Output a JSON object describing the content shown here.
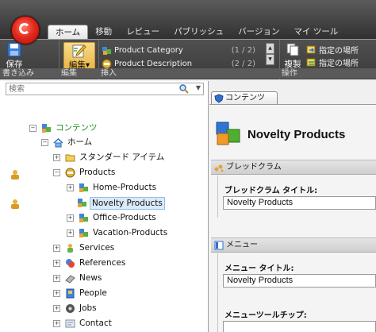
{
  "ribbon": {
    "tabs": [
      "ホーム",
      "移動",
      "レビュー",
      "パブリッシュ",
      "バージョン",
      "マイ ツール"
    ],
    "active_tab": 0,
    "save_label": "保存",
    "edit_label": "編集",
    "edit_arrow": "▾",
    "copy_label": "複製",
    "insert_items": [
      {
        "label": "Product Category",
        "count": "(1 / 2)"
      },
      {
        "label": "Product Description",
        "count": "(2 / 2)"
      }
    ],
    "op_items": [
      "指定の場所",
      "指定の場所"
    ],
    "group_labels": {
      "write": "書き込み",
      "edit": "編集",
      "insert": "挿入",
      "operation": "操作"
    }
  },
  "search": {
    "placeholder": "検索",
    "value": "検索"
  },
  "tree": [
    {
      "label": "コンテンツ",
      "icon": "content-icon",
      "expand": "−",
      "level": 0,
      "color": "#1a8a1a"
    },
    {
      "label": "ホーム",
      "icon": "home-icon",
      "expand": "−",
      "level": 1
    },
    {
      "label": "スタンダード アイテム",
      "icon": "folder-icon",
      "expand": "+",
      "level": 2
    },
    {
      "label": "Products",
      "icon": "products-icon",
      "expand": "−",
      "level": 2
    },
    {
      "label": "Home-Products",
      "icon": "product-group-icon",
      "expand": "+",
      "level": 3
    },
    {
      "label": "Novelty Products",
      "icon": "product-group-icon",
      "expand": "",
      "level": 3,
      "selected": true
    },
    {
      "label": "Office-Products",
      "icon": "product-group-icon",
      "expand": "+",
      "level": 3
    },
    {
      "label": "Vacation-Products",
      "icon": "product-group-icon",
      "expand": "+",
      "level": 3
    },
    {
      "label": "Services",
      "icon": "services-icon",
      "expand": "+",
      "level": 2
    },
    {
      "label": "References",
      "icon": "references-icon",
      "expand": "+",
      "level": 2
    },
    {
      "label": "News",
      "icon": "news-icon",
      "expand": "+",
      "level": 2
    },
    {
      "label": "People",
      "icon": "people-icon",
      "expand": "+",
      "level": 2
    },
    {
      "label": "Jobs",
      "icon": "jobs-icon",
      "expand": "+",
      "level": 2
    },
    {
      "label": "Contact",
      "icon": "contact-icon",
      "expand": "+",
      "level": 2
    }
  ],
  "content": {
    "tab_label": "コンテンツ",
    "title": "Novelty Products",
    "breadcrumb_section": "ブレッドクラム",
    "breadcrumb_title_label": "ブレッドクラム タイトル:",
    "breadcrumb_title_value": "Novelty Products",
    "menu_section": "メニュー",
    "menu_title_label": "メニュー タイトル:",
    "menu_title_value": "Novelty Products",
    "menu_tooltip_label": "メニューツールチップ:"
  },
  "colors": {
    "accent": "#e52a1e",
    "selection": "#dbeaf9",
    "ribbon_dark": "#3a3a3a"
  }
}
